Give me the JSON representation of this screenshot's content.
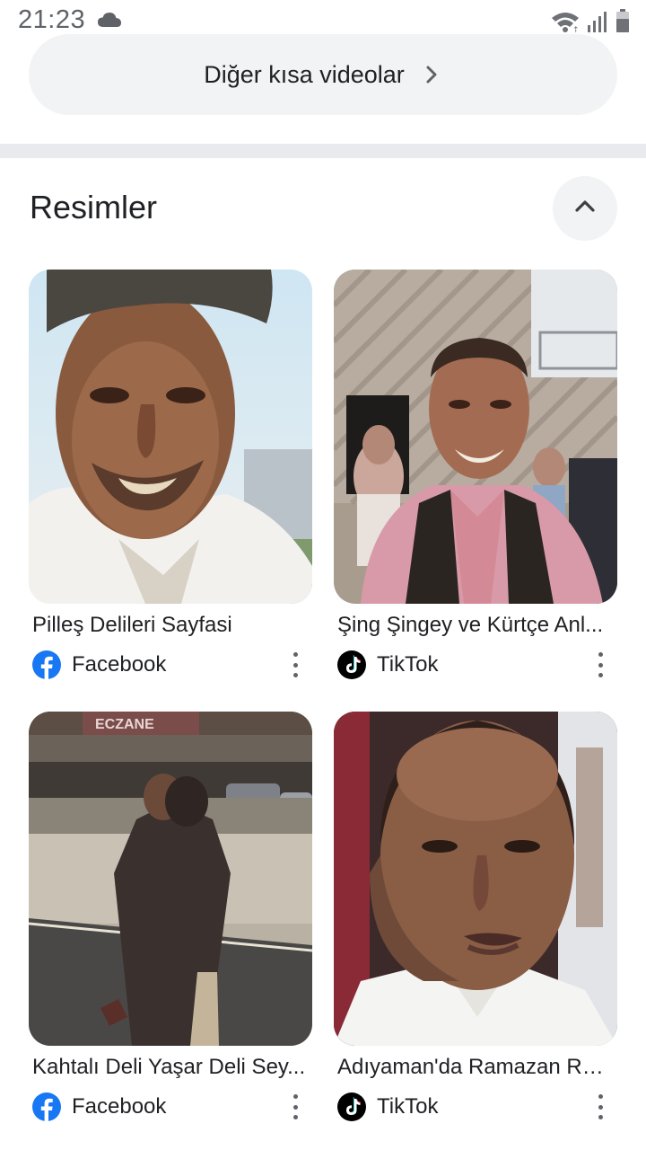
{
  "status_bar": {
    "time": "21:23",
    "icons": [
      "cloud-icon",
      "wifi-icon",
      "signal-icon",
      "battery-icon"
    ]
  },
  "more_videos": {
    "label": "Diğer kısa videolar",
    "icon": "chevron-right-icon"
  },
  "images_section": {
    "title": "Resimler",
    "collapse_icon": "chevron-up-icon",
    "results": [
      {
        "title": "Pilleş Delileri Sayfasi",
        "source": "Facebook",
        "source_icon": "facebook-icon"
      },
      {
        "title": "Şing Şingey ve Kürtçe Anl...",
        "source": "TikTok",
        "source_icon": "tiktok-icon"
      },
      {
        "title": "Kahtalı Deli Yaşar Deli Sey...",
        "source": "Facebook",
        "source_icon": "facebook-icon"
      },
      {
        "title": "Adıyaman'da Ramazan Rö...",
        "source": "TikTok",
        "source_icon": "tiktok-icon"
      }
    ],
    "thumbnail_sign_text": "ECZANE"
  },
  "colors": {
    "facebook": "#1877f2",
    "tiktok": "#000000",
    "pill_bg": "#f1f3f4",
    "divider": "#e8eaed"
  }
}
